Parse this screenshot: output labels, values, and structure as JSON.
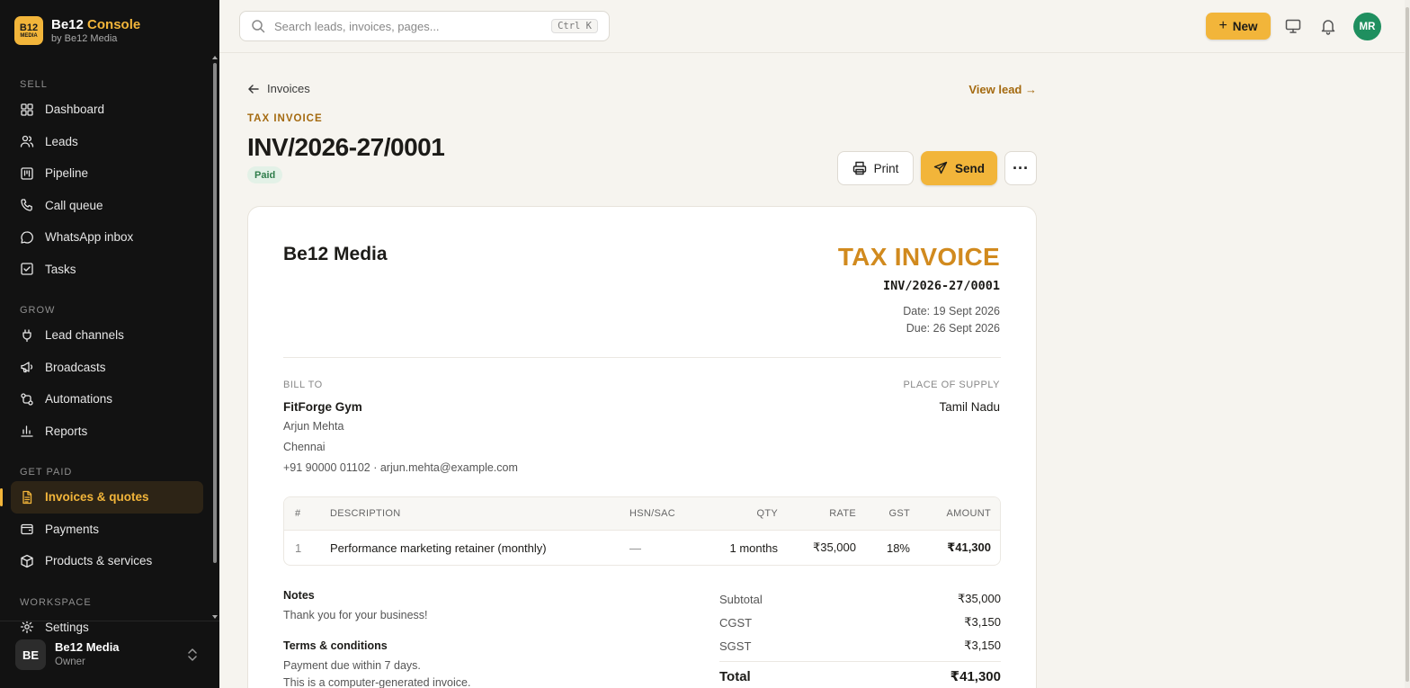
{
  "brand": {
    "logo_top": "B12",
    "logo_bottom": "MEDIA",
    "name_part1": "Be12",
    "name_part2": "Console",
    "subtitle": "by Be12 Media"
  },
  "colors": {
    "accent": "#f2b53a",
    "sidebar_bg": "#121212",
    "paid_green": "#2f7d4b",
    "avatar_green": "#1f8f5f",
    "invoice_orange": "#d18a1e"
  },
  "sidebar": {
    "sections": [
      {
        "label": "SELL",
        "items": [
          {
            "label": "Dashboard",
            "icon": "grid-icon"
          },
          {
            "label": "Leads",
            "icon": "users-icon"
          },
          {
            "label": "Pipeline",
            "icon": "kanban-icon"
          },
          {
            "label": "Call queue",
            "icon": "phone-icon"
          },
          {
            "label": "WhatsApp inbox",
            "icon": "chat-bubble-icon"
          },
          {
            "label": "Tasks",
            "icon": "checkbox-icon"
          }
        ]
      },
      {
        "label": "GROW",
        "items": [
          {
            "label": "Lead channels",
            "icon": "plug-icon"
          },
          {
            "label": "Broadcasts",
            "icon": "megaphone-icon"
          },
          {
            "label": "Automations",
            "icon": "workflow-icon"
          },
          {
            "label": "Reports",
            "icon": "bar-chart-icon"
          }
        ]
      },
      {
        "label": "GET PAID",
        "items": [
          {
            "label": "Invoices & quotes",
            "icon": "file-text-icon",
            "active": true
          },
          {
            "label": "Payments",
            "icon": "wallet-icon"
          },
          {
            "label": "Products & services",
            "icon": "package-icon"
          }
        ]
      },
      {
        "label": "WORKSPACE",
        "items": [
          {
            "label": "Settings",
            "icon": "gear-icon"
          }
        ]
      }
    ],
    "workspace": {
      "initials": "BE",
      "name": "Be12 Media",
      "role": "Owner"
    }
  },
  "topbar": {
    "search_placeholder": "Search leads, invoices, pages...",
    "search_shortcut": "Ctrl K",
    "new_label": "New",
    "user_initials": "MR"
  },
  "page": {
    "back_label": "Invoices",
    "view_lead_label": "View lead →",
    "eyebrow": "TAX INVOICE",
    "invoice_number": "INV/2026-27/0001",
    "status": "Paid",
    "print_label": "Print",
    "send_label": "Send",
    "more_label": "···"
  },
  "invoice": {
    "company": "Be12 Media",
    "doc_type": "TAX INVOICE",
    "number": "INV/2026-27/0001",
    "date": "Date: 19 Sept 2026",
    "due": "Due: 26 Sept 2026",
    "bill_to_label": "BILL TO",
    "bill_to": {
      "name": "FitForge Gym",
      "contact": "Arjun Mehta",
      "city": "Chennai",
      "phone_email": "+91 90000 01102 · arjun.mehta@example.com"
    },
    "place_of_supply_label": "PLACE OF SUPPLY",
    "place_of_supply": "Tamil Nadu",
    "columns": {
      "no": "#",
      "desc": "DESCRIPTION",
      "hsn": "HSN/SAC",
      "qty": "QTY",
      "rate": "RATE",
      "gst": "GST",
      "amount": "AMOUNT"
    },
    "items": [
      {
        "no": "1",
        "desc": "Performance marketing retainer (monthly)",
        "hsn": "—",
        "qty": "1 months",
        "rate": "₹35,000",
        "gst": "18%",
        "amount": "₹41,300"
      }
    ],
    "notes_label": "Notes",
    "notes": "Thank you for your business!",
    "terms_label": "Terms & conditions",
    "terms_line1": "Payment due within 7 days.",
    "terms_line2": "This is a computer-generated invoice.",
    "totals": {
      "subtotal_label": "Subtotal",
      "subtotal": "₹35,000",
      "cgst_label": "CGST",
      "cgst": "₹3,150",
      "sgst_label": "SGST",
      "sgst": "₹3,150",
      "total_label": "Total",
      "total": "₹41,300"
    }
  }
}
